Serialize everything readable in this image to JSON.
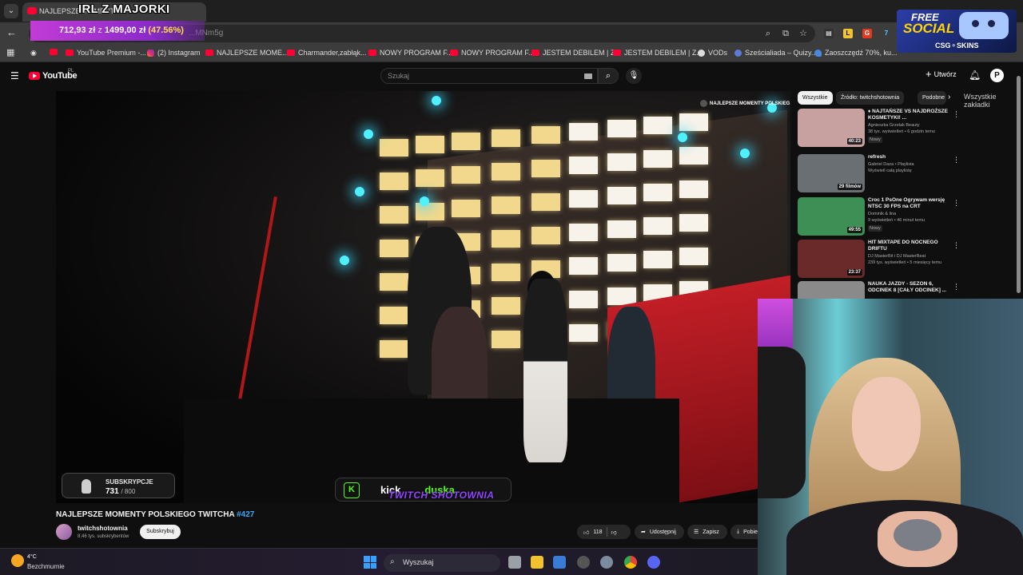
{
  "browser": {
    "tab_title": "NAJLEPSZE MOMENTY...",
    "url": "...MNm5g",
    "bookmarks": [
      {
        "label": "YouTube Premium -...",
        "icon": "youtube-icon"
      },
      {
        "label": "(2) Instagram",
        "icon": "instagram-icon"
      },
      {
        "label": "NAJLEPSZE MOME...",
        "icon": "youtube-icon"
      },
      {
        "label": "Charmander,zabłąk...",
        "icon": "youtube-icon"
      },
      {
        "label": "NOWY PROGRAM F...",
        "icon": "youtube-icon"
      },
      {
        "label": "NOWY PROGRAM F...",
        "icon": "youtube-icon"
      },
      {
        "label": "JESTEM DEBILEM | Z...",
        "icon": "youtube-icon"
      },
      {
        "label": "JESTEM DEBILEM | Z...",
        "icon": "youtube-icon"
      },
      {
        "label": "VODs",
        "icon": "globe-icon"
      },
      {
        "label": "Sześcialiada – Quizy...",
        "icon": "quiz-icon"
      },
      {
        "label": "Zaoszczędź 70%, ku...",
        "icon": "bird-icon"
      }
    ],
    "bookmarks_all": "Wszystkie zakładki"
  },
  "stream_overlay": {
    "title": "IRL Z MAJORKI",
    "price_current": "712,93 zł",
    "price_sep": "z",
    "price_total": "1499,00 zł",
    "price_percent": "(47.56%)",
    "promo_line1": "FREE",
    "promo_line2": "SOCIAL",
    "promo_line3": "CSG⚬SKINS",
    "sub_goal_label": "SUBSKRYPCJE",
    "sub_goal_current": "731",
    "sub_goal_max": "/ 800",
    "kick_prefix": "kick",
    "kick_user": "duska",
    "twitch_logo": "TWITCH SHOTOWNIA"
  },
  "youtube": {
    "logo": "YouTube",
    "region": "PL",
    "search_placeholder": "Szukaj",
    "create_label": "Utwórz",
    "avatar_letter": "P",
    "video_watermark": "NAJLEPSZE MOMENTY POLSKIEG",
    "video_title": "NAJLEPSZE MOMENTY POLSKIEGO TWITCHA ",
    "video_hashtag": "#427",
    "channel_name": "twitchshotownia",
    "channel_subs": "8,46 tys. subskrybentów",
    "subscribe_label": "Subskrybuj",
    "like_count": "118",
    "share_label": "Udostępnij",
    "save_label": "Zapisz",
    "download_label": "Pobie"
  },
  "sidebar": {
    "chips": [
      "Wszystkie",
      "Źródło: twitchshotownia",
      "Podobne"
    ],
    "recommendations": [
      {
        "title": "♦ NAJTAŃSZE VS NAJDROŻSZE KOSMETYKI! ...",
        "channel": "Agnieszka Grzelak Beauty",
        "meta": "38 tys. wyświetleń • 6 godzin temu",
        "badge": "Nowy",
        "duration": "40:23",
        "thumb_color": "#c7a0a0"
      },
      {
        "title": "refresh",
        "channel": "Gabriel Daza • Playlista",
        "meta": "Wyświetl całą playlistę",
        "badge": "",
        "duration": "29 filmów",
        "thumb_color": "#6a6f74"
      },
      {
        "title": "Croc 1 PsOne Ogrywam wersję NTSC 30 FPS na CRT",
        "channel": "Dominik & lina",
        "meta": "9 wyświetleń • 46 minut temu",
        "badge": "Nowy",
        "duration": "49:55",
        "thumb_color": "#3e8f55"
      },
      {
        "title": "HIT MIXTAPE DO NOCNEGO DRIFTU",
        "channel": "DJ MasterBit i DJ MasterBeat",
        "meta": "239 tys. wyświetleń • 5 miesięcy temu",
        "badge": "",
        "duration": "23:37",
        "thumb_color": "#6b2a2a"
      },
      {
        "title": "NAUKA JAZDY - SEZON 6, ODCINEK 8 [CAŁY ODCINEK] ...",
        "channel": "",
        "meta": "",
        "badge": "",
        "duration": "",
        "thumb_color": "#8a8a8a"
      }
    ]
  },
  "taskbar": {
    "temperature": "4°C",
    "weather": "Bezchmurnie",
    "search_label": "Wyszukaj"
  },
  "colors": {
    "youtube_red": "#ff0033",
    "kick_green": "#53fc18",
    "twitch_purple": "#9146ff",
    "link_blue": "#3ea6ff"
  }
}
